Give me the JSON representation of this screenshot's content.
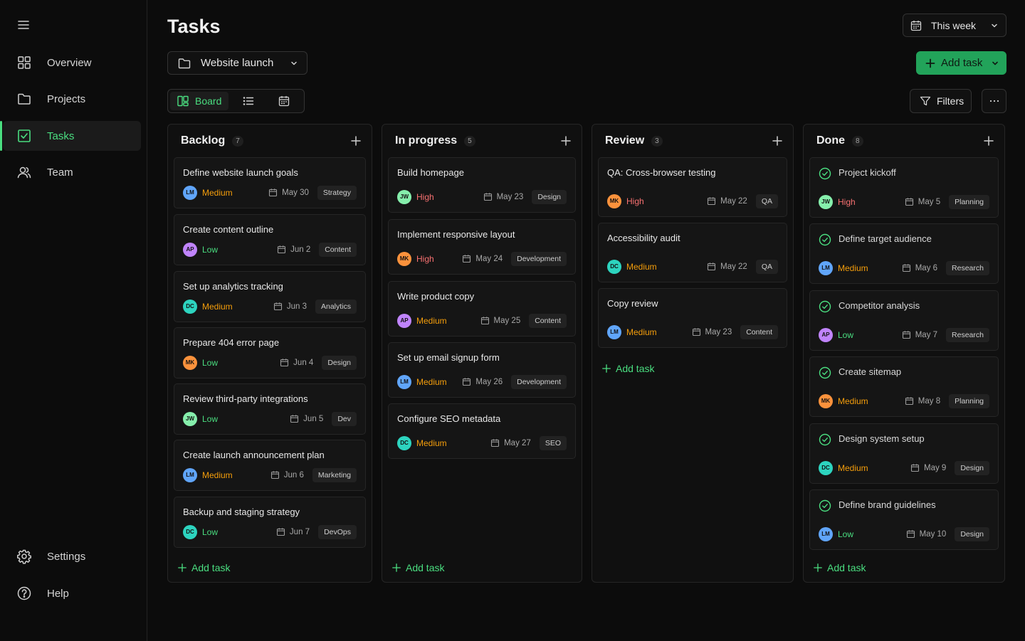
{
  "colors": {
    "accent": "#4ade80",
    "high": "#f87171",
    "medium": "#f59e0b",
    "low": "#4ade80"
  },
  "sidebar": {
    "items": [
      {
        "label": "Overview",
        "icon": "grid-icon"
      },
      {
        "label": "Projects",
        "icon": "folder-icon"
      },
      {
        "label": "Tasks",
        "icon": "checkbox-icon"
      },
      {
        "label": "Team",
        "icon": "users-icon"
      }
    ],
    "bottom": [
      {
        "label": "Settings",
        "icon": "gear-icon"
      },
      {
        "label": "Help",
        "icon": "help-icon"
      }
    ]
  },
  "header": {
    "title": "Tasks",
    "project": "Website launch",
    "range": "This week",
    "add_task": "Add task",
    "board": "Board",
    "filters": "Filters"
  },
  "columns": [
    {
      "title": "Backlog",
      "count": "7",
      "add_task": "Add task",
      "cards": [
        {
          "title": "Define website launch goals",
          "avatar": "LM",
          "avatar_color": "#60a5fa",
          "priority": "Medium",
          "date": "May 30",
          "tag": "Strategy"
        },
        {
          "title": "Create content outline",
          "avatar": "AP",
          "avatar_color": "#c084fc",
          "priority": "Low",
          "date": "Jun 2",
          "tag": "Content"
        },
        {
          "title": "Set up analytics tracking",
          "avatar": "DC",
          "avatar_color": "#2dd4bf",
          "priority": "Medium",
          "date": "Jun 3",
          "tag": "Analytics"
        },
        {
          "title": "Prepare 404 error page",
          "avatar": "MK",
          "avatar_color": "#fb923c",
          "priority": "Low",
          "date": "Jun 4",
          "tag": "Design"
        },
        {
          "title": "Review third-party integrations",
          "avatar": "JW",
          "avatar_color": "#86efac",
          "priority": "Low",
          "date": "Jun 5",
          "tag": "Dev"
        },
        {
          "title": "Create launch announcement plan",
          "avatar": "LM",
          "avatar_color": "#60a5fa",
          "priority": "Medium",
          "date": "Jun 6",
          "tag": "Marketing"
        },
        {
          "title": "Backup and staging strategy",
          "avatar": "DC",
          "avatar_color": "#2dd4bf",
          "priority": "Low",
          "date": "Jun 7",
          "tag": "DevOps"
        }
      ]
    },
    {
      "title": "In progress",
      "count": "5",
      "add_task": "Add task",
      "cards": [
        {
          "title": "Build homepage",
          "avatar": "JW",
          "avatar_color": "#86efac",
          "priority": "High",
          "date": "May 23",
          "tag": "Design"
        },
        {
          "title": "Implement responsive layout",
          "avatar": "MK",
          "avatar_color": "#fb923c",
          "priority": "High",
          "date": "May 24",
          "tag": "Development"
        },
        {
          "title": "Write product copy",
          "avatar": "AP",
          "avatar_color": "#c084fc",
          "priority": "Medium",
          "date": "May 25",
          "tag": "Content"
        },
        {
          "title": "Set up email signup form",
          "avatar": "LM",
          "avatar_color": "#60a5fa",
          "priority": "Medium",
          "date": "May 26",
          "tag": "Development"
        },
        {
          "title": "Configure SEO metadata",
          "avatar": "DC",
          "avatar_color": "#2dd4bf",
          "priority": "Medium",
          "date": "May 27",
          "tag": "SEO"
        }
      ]
    },
    {
      "title": "Review",
      "count": "3",
      "add_task": "Add task",
      "cards": [
        {
          "title": "QA: Cross-browser testing",
          "avatar": "MK",
          "avatar_color": "#fb923c",
          "priority": "High",
          "date": "May 22",
          "tag": "QA"
        },
        {
          "title": "Accessibility audit",
          "avatar": "DC",
          "avatar_color": "#2dd4bf",
          "priority": "Medium",
          "date": "May 22",
          "tag": "QA"
        },
        {
          "title": "Copy review",
          "avatar": "LM",
          "avatar_color": "#60a5fa",
          "priority": "Medium",
          "date": "May 23",
          "tag": "Content"
        }
      ]
    },
    {
      "title": "Done",
      "count": "8",
      "add_task": "Add task",
      "cards": [
        {
          "title": "Project kickoff",
          "avatar": "JW",
          "avatar_color": "#86efac",
          "priority": "High",
          "date": "May 5",
          "tag": "Planning"
        },
        {
          "title": "Define target audience",
          "avatar": "LM",
          "avatar_color": "#60a5fa",
          "priority": "Medium",
          "date": "May 6",
          "tag": "Research"
        },
        {
          "title": "Competitor analysis",
          "avatar": "AP",
          "avatar_color": "#c084fc",
          "priority": "Low",
          "date": "May 7",
          "tag": "Research"
        },
        {
          "title": "Create sitemap",
          "avatar": "MK",
          "avatar_color": "#fb923c",
          "priority": "Medium",
          "date": "May 8",
          "tag": "Planning"
        },
        {
          "title": "Design system setup",
          "avatar": "DC",
          "avatar_color": "#2dd4bf",
          "priority": "Medium",
          "date": "May 9",
          "tag": "Design"
        },
        {
          "title": "Define brand guidelines",
          "avatar": "LM",
          "avatar_color": "#60a5fa",
          "priority": "Low",
          "date": "May 10",
          "tag": "Design"
        }
      ]
    }
  ]
}
